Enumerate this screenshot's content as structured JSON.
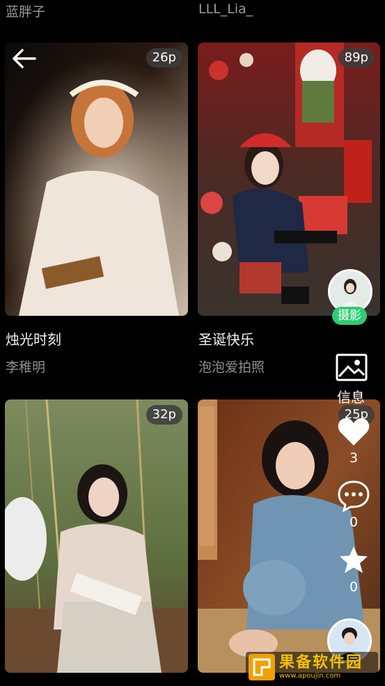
{
  "top_authors": {
    "left": "蓝胖子",
    "right": "LLL_Lia_"
  },
  "cards": [
    {
      "count": "26p",
      "title": "烛光时刻",
      "author": "李稚明"
    },
    {
      "count": "89p",
      "title": "圣诞快乐",
      "author": "泡泡爱拍照"
    },
    {
      "count": "32p",
      "title": "",
      "author": ""
    },
    {
      "count": "25p",
      "title": "",
      "author": ""
    }
  ],
  "side_panel": {
    "badge": "摄影",
    "info_label": "信息",
    "likes": "3",
    "comments": "0",
    "favorites": "0"
  },
  "watermark": {
    "main": "果备软件园",
    "sub": "www.apoujin.com"
  },
  "colors": {
    "background": "#000000",
    "accent_green": "#2ecc71",
    "watermark": "#f5c000"
  },
  "icons": [
    "back-arrow-icon",
    "image-icon",
    "heart-icon",
    "comment-icon",
    "star-icon"
  ]
}
